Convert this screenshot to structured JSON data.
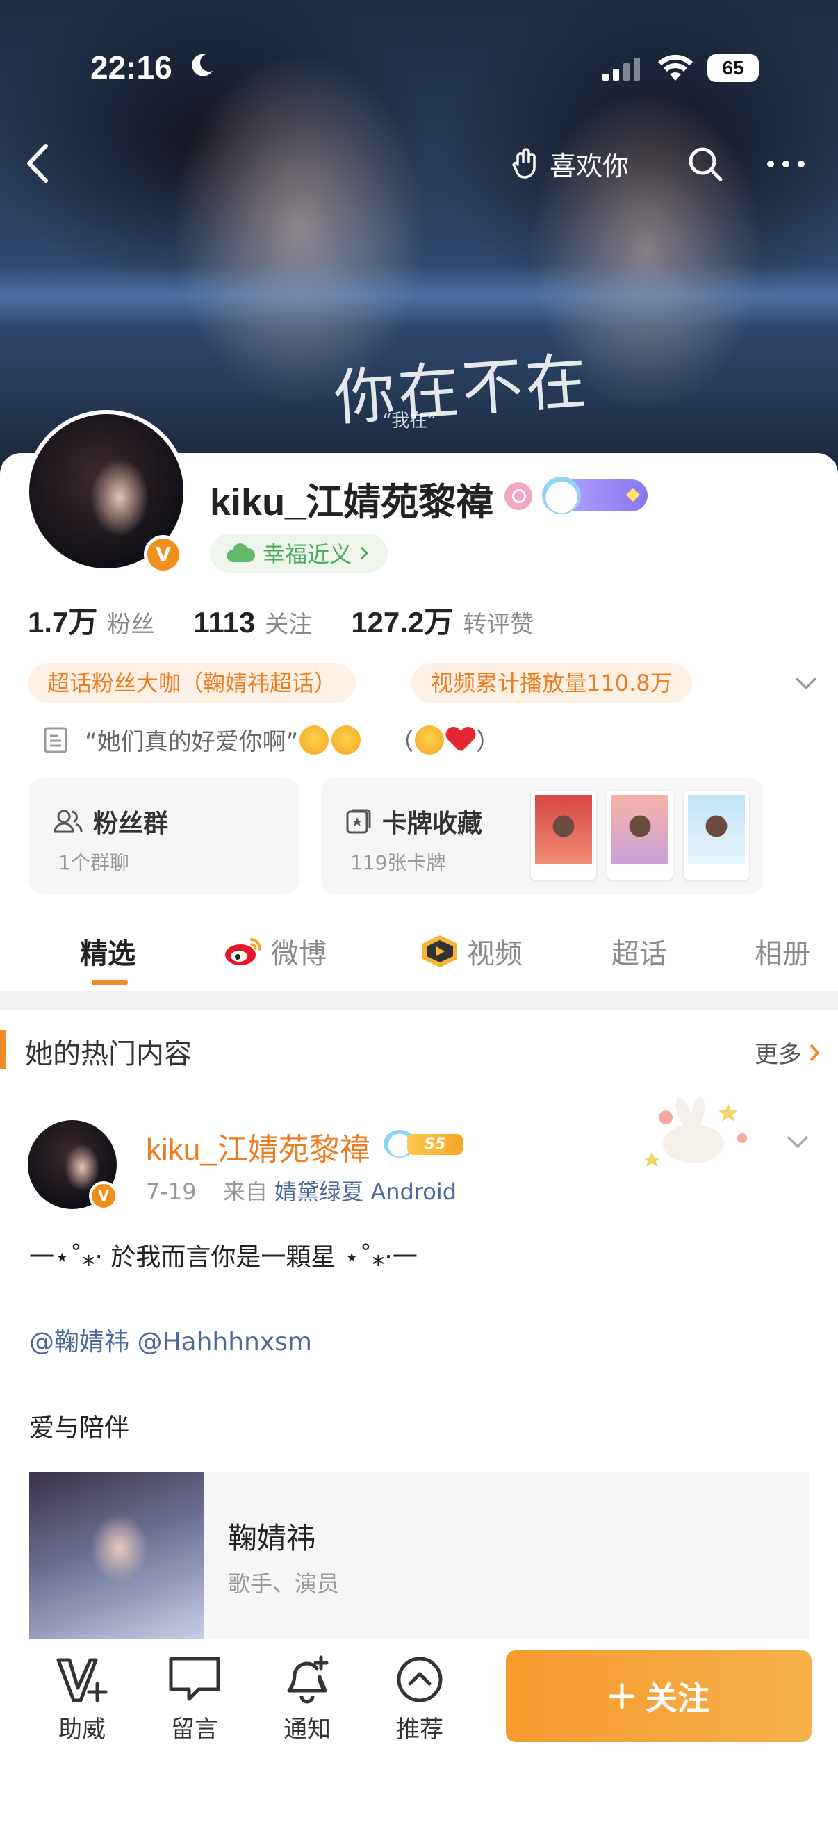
{
  "status_bar": {
    "time": "22:16",
    "battery": "65"
  },
  "cover": {
    "title": "你在不在",
    "subtitle": "“我在”"
  },
  "nav": {
    "like_label": "喜欢你"
  },
  "profile": {
    "username": "kiku_江婧苑黎禕",
    "fortune_tag": "幸福近义",
    "stats": [
      {
        "num": "1.7万",
        "label": "粉丝"
      },
      {
        "num": "1113",
        "label": "关注"
      },
      {
        "num": "127.2万",
        "label": "转评赞"
      }
    ],
    "honors": [
      "超话粉丝大咖（鞠婧祎超话）",
      "视频累计播放量110.8万"
    ],
    "bio_quote": "“她们真的好爱你啊”",
    "bio_paren_open": "（",
    "bio_paren_close": "）",
    "fans_card": {
      "title": "粉丝群",
      "sub": "1个群聊"
    },
    "cards_card": {
      "title": "卡牌收藏",
      "sub": "119张卡牌"
    }
  },
  "tabs": [
    {
      "label": "精选"
    },
    {
      "label": "微博"
    },
    {
      "label": "视频"
    },
    {
      "label": "超话"
    },
    {
      "label": "相册"
    }
  ],
  "hot": {
    "title": "她的热门内容",
    "more": "更多"
  },
  "post": {
    "username": "kiku_江婧苑黎禕",
    "level": "S5",
    "date": "7-19",
    "from_prefix": "来自",
    "source": "婧黛绿夏 Android",
    "line1": "一⋆˚⁎⋅ 於我而言你是一顆星 ⋆˚⁎⋅一",
    "mentions": "@鞠婧祎 @Hahhhnxsm",
    "line3": "爱与陪伴",
    "link_card": {
      "title": "鞠婧祎",
      "subtitle": "歌手、演员"
    }
  },
  "bottom_bar": {
    "items": [
      {
        "label": "助威",
        "icon": "cheer-v-icon"
      },
      {
        "label": "留言",
        "icon": "message-icon"
      },
      {
        "label": "通知",
        "icon": "bell-icon"
      },
      {
        "label": "推荐",
        "icon": "recommend-icon"
      }
    ],
    "follow": "关注"
  },
  "colors": {
    "accent": "#f08a26",
    "link": "#4a6a9a",
    "fortune_green": "#4daa5a"
  }
}
